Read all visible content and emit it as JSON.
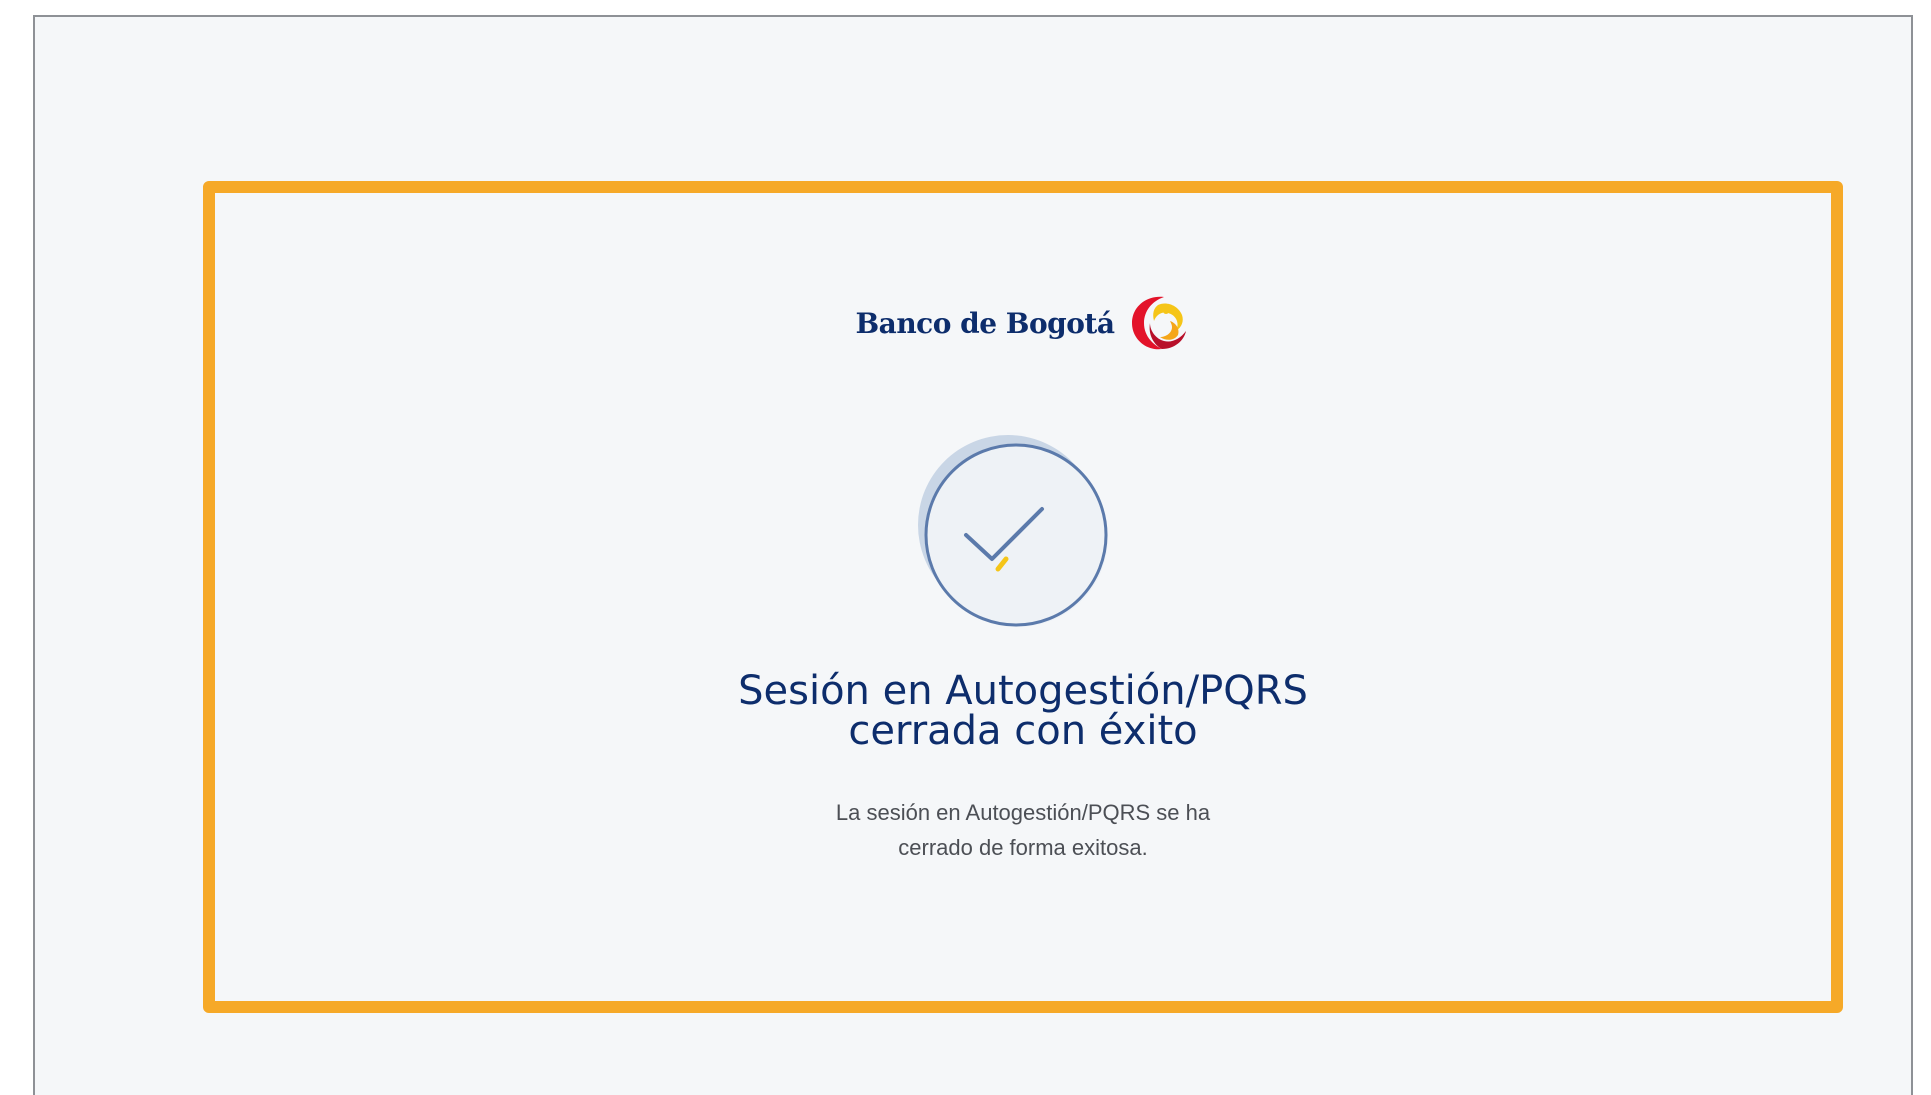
{
  "brand": {
    "name": "Banco de Bogotá",
    "logo_icon": "banco-de-bogota-swirl-icon"
  },
  "status": {
    "icon": "success-check-icon",
    "title_line1": "Sesión en Autogestión/PQRS",
    "title_line2": "cerrada con éxito",
    "message_line1": "La sesión en Autogestión/PQRS se ha",
    "message_line2": "cerrado de forma exitosa."
  },
  "colors": {
    "highlight_border": "#f6a928",
    "brand_navy": "#0d2d6c",
    "background": "#f5f7f9",
    "check_stroke": "#5b7aab",
    "check_accent": "#f5c518"
  }
}
